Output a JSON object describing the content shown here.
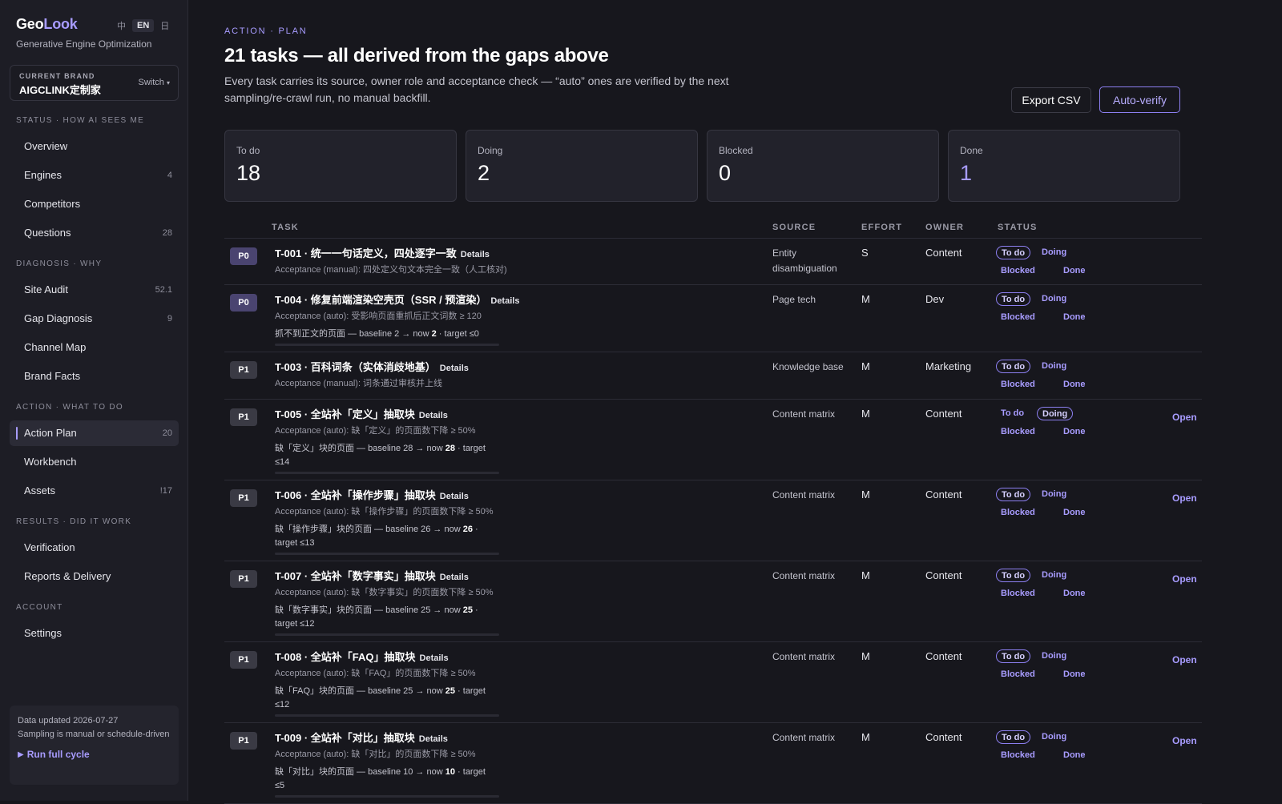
{
  "sidebar": {
    "logo": {
      "part1": "Geo",
      "part2": "Look"
    },
    "lang": {
      "zh": "中",
      "en": "EN",
      "ja": "日"
    },
    "tagline": "Generative Engine Optimization",
    "brand": {
      "caption": "CURRENT BRAND",
      "name": "AIGCLINK定制家",
      "switch": "Switch"
    },
    "sections": {
      "status": "STATUS · HOW AI SEES ME",
      "diagnosis": "DIAGNOSIS · WHY",
      "action": "ACTION · WHAT TO DO",
      "results": "RESULTS · DID IT WORK",
      "account": "ACCOUNT"
    },
    "items": [
      {
        "label": "Overview",
        "count": ""
      },
      {
        "label": "Engines",
        "count": "4"
      },
      {
        "label": "Competitors",
        "count": ""
      },
      {
        "label": "Questions",
        "count": "28"
      },
      {
        "label": "Site Audit",
        "count": "52.1"
      },
      {
        "label": "Gap Diagnosis",
        "count": "9"
      },
      {
        "label": "Channel Map",
        "count": ""
      },
      {
        "label": "Brand Facts",
        "count": ""
      },
      {
        "label": "Action Plan",
        "count": "20"
      },
      {
        "label": "Workbench",
        "count": ""
      },
      {
        "label": "Assets",
        "count": "!17"
      },
      {
        "label": "Verification",
        "count": ""
      },
      {
        "label": "Reports & Delivery",
        "count": ""
      },
      {
        "label": "Settings",
        "count": ""
      }
    ],
    "footer": {
      "line1": "Data updated 2026-07-27",
      "line2": "Sampling is manual or schedule-driven",
      "run_label": "Run full cycle"
    }
  },
  "header": {
    "eyebrow": "ACTION · PLAN",
    "title": "21 tasks — all derived from the gaps above",
    "description": "Every task carries its source, owner role and acceptance check — “auto” ones are verified by the next sampling/re-crawl run, no manual backfill.",
    "export_label": "Export CSV",
    "verify_label": "Auto-verify"
  },
  "stats": [
    {
      "label": "To do",
      "value": "18"
    },
    {
      "label": "Doing",
      "value": "2"
    },
    {
      "label": "Blocked",
      "value": "0"
    },
    {
      "label": "Done",
      "value": "1"
    }
  ],
  "table": {
    "headers": {
      "task": "TASK",
      "source": "SOURCE",
      "effort": "EFFORT",
      "owner": "OWNER",
      "status": "STATUS"
    },
    "status_labels": {
      "todo": "To do",
      "doing": "Doing",
      "blocked": "Blocked",
      "done": "Done"
    },
    "details_label": "Details",
    "open_label": "Open",
    "rows": [
      {
        "priority": "P0",
        "title": "T-001 · 统一一句话定义，四处逐字一致",
        "acceptance": "Acceptance (manual): 四处定义句文本完全一致（人工核对)",
        "metric_prefix": "",
        "metric_now": "",
        "metric_suffix": "",
        "progress": 0,
        "source": "Entity disambiguation",
        "effort": "S",
        "owner": "Content",
        "status": "todo",
        "open": false
      },
      {
        "priority": "P0",
        "title": "T-004 · 修复前端渲染空壳页（SSR / 预渲染）",
        "acceptance": "Acceptance (auto): 受影响页面重抓后正文词数 ≥ 120",
        "metric_prefix": "抓不到正文的页面 — baseline 2 → now ",
        "metric_now": "2",
        "metric_suffix": " · target ≤0",
        "progress": 0,
        "source": "Page tech",
        "effort": "M",
        "owner": "Dev",
        "status": "todo",
        "open": false
      },
      {
        "priority": "P1",
        "title": "T-003 · 百科词条（实体消歧地基）",
        "acceptance": "Acceptance (manual): 词条通过审核并上线",
        "metric_prefix": "",
        "metric_now": "",
        "metric_suffix": "",
        "progress": 0,
        "source": "Knowledge base",
        "effort": "M",
        "owner": "Marketing",
        "status": "todo",
        "open": false
      },
      {
        "priority": "P1",
        "title": "T-005 · 全站补「定义」抽取块",
        "acceptance": "Acceptance (auto): 缺「定义」的页面数下降 ≥ 50%",
        "metric_prefix": "缺「定义」块的页面 — baseline 28 → now ",
        "metric_now": "28",
        "metric_suffix": " · target ≤14",
        "progress": 0,
        "source": "Content matrix",
        "effort": "M",
        "owner": "Content",
        "status": "doing",
        "open": true
      },
      {
        "priority": "P1",
        "title": "T-006 · 全站补「操作步骤」抽取块",
        "acceptance": "Acceptance (auto): 缺「操作步骤」的页面数下降 ≥ 50%",
        "metric_prefix": "缺「操作步骤」块的页面 — baseline 26 → now ",
        "metric_now": "26",
        "metric_suffix": " · target ≤13",
        "progress": 0,
        "source": "Content matrix",
        "effort": "M",
        "owner": "Content",
        "status": "todo",
        "open": true
      },
      {
        "priority": "P1",
        "title": "T-007 · 全站补「数字事实」抽取块",
        "acceptance": "Acceptance (auto): 缺「数字事实」的页面数下降 ≥ 50%",
        "metric_prefix": "缺「数字事实」块的页面 — baseline 25 → now ",
        "metric_now": "25",
        "metric_suffix": " · target ≤12",
        "progress": 0,
        "source": "Content matrix",
        "effort": "M",
        "owner": "Content",
        "status": "todo",
        "open": true
      },
      {
        "priority": "P1",
        "title": "T-008 · 全站补「FAQ」抽取块",
        "acceptance": "Acceptance (auto): 缺「FAQ」的页面数下降 ≥ 50%",
        "metric_prefix": "缺「FAQ」块的页面 — baseline 25 → now ",
        "metric_now": "25",
        "metric_suffix": " · target ≤12",
        "progress": 0,
        "source": "Content matrix",
        "effort": "M",
        "owner": "Content",
        "status": "todo",
        "open": true
      },
      {
        "priority": "P1",
        "title": "T-009 · 全站补「对比」抽取块",
        "acceptance": "Acceptance (auto): 缺「对比」的页面数下降 ≥ 50%",
        "metric_prefix": "缺「对比」块的页面 — baseline 10 → now ",
        "metric_now": "10",
        "metric_suffix": " · target ≤5",
        "progress": 0,
        "source": "Content matrix",
        "effort": "M",
        "owner": "Content",
        "status": "todo",
        "open": true
      }
    ]
  }
}
